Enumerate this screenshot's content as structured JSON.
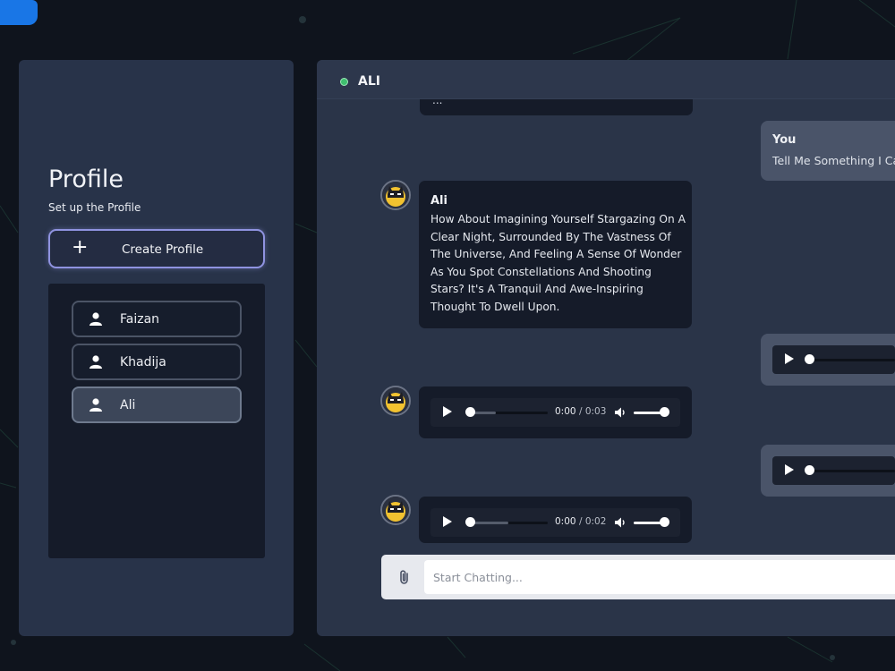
{
  "sidebar": {
    "title": "Profile",
    "subtitle": "Set up the Profile",
    "create_button": {
      "icon": "plus-icon",
      "label": "Create Profile"
    },
    "profiles": [
      {
        "name": "Faizan",
        "icon": "user-icon",
        "active": false
      },
      {
        "name": "Khadija",
        "icon": "user-icon",
        "active": false
      },
      {
        "name": "Ali",
        "icon": "user-icon",
        "active": true
      }
    ]
  },
  "chat": {
    "contact_name": "ALI",
    "status": "online",
    "status_color": "#3fbf6f",
    "messages": [
      {
        "from": "ai",
        "type": "text-cut",
        "text": "..."
      },
      {
        "from": "user",
        "type": "text",
        "sender": "You",
        "text": "Tell Me Something I Can"
      },
      {
        "from": "ai",
        "type": "text",
        "sender": "Ali",
        "avatar": "batman-avatar-icon",
        "text": "How About Imagining Yourself Stargazing On A Clear Night, Surrounded By The Vastness Of The Universe, And Feeling A Sense Of Wonder As You Spot Constellations And Shooting Stars? It's A Tranquil And Awe-Inspiring Thought To Dwell Upon."
      },
      {
        "from": "user",
        "type": "audio"
      },
      {
        "from": "ai",
        "type": "audio",
        "avatar": "batman-avatar-icon",
        "current": "0:00",
        "duration": "0:03",
        "progress": 0.0
      },
      {
        "from": "user",
        "type": "audio"
      },
      {
        "from": "ai",
        "type": "audio",
        "avatar": "batman-avatar-icon",
        "current": "0:00",
        "duration": "0:02",
        "progress": 0.0
      }
    ],
    "input": {
      "placeholder": "Start Chatting...",
      "value": "",
      "attach_icon": "paperclip-icon"
    }
  },
  "colors": {
    "background": "#0f141d",
    "panel": "#283349",
    "accent_border": "#8f93e0",
    "bubble_ai": "#151b29",
    "bubble_user": "#4a5469"
  }
}
